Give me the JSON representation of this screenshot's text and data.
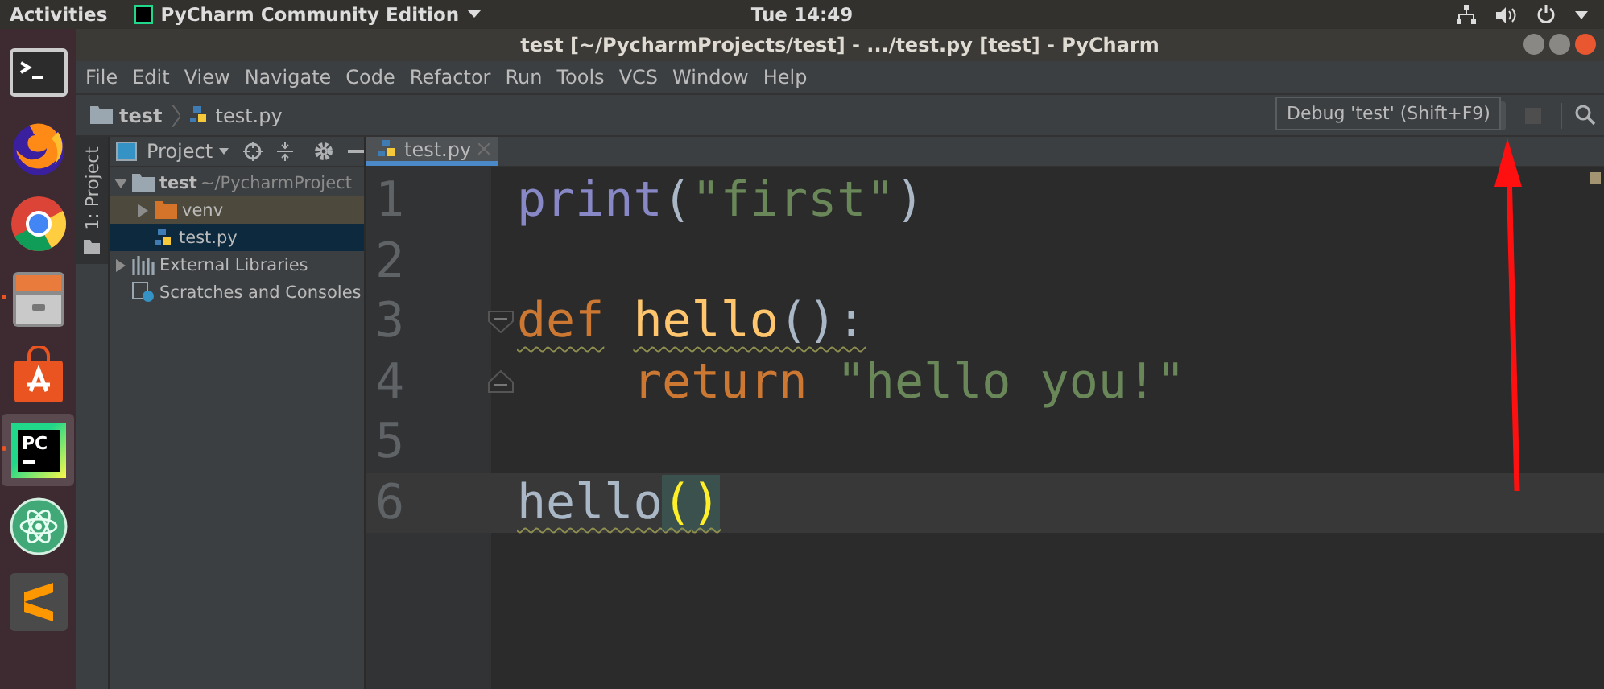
{
  "top_bar": {
    "activities": "Activities",
    "app_menu": "PyCharm Community Edition",
    "clock": "Tue 14:49"
  },
  "dock": [
    {
      "kind": "terminal",
      "running": false,
      "selected": false
    },
    {
      "kind": "fox",
      "running": false,
      "selected": false
    },
    {
      "kind": "browser",
      "running": false,
      "selected": false
    },
    {
      "kind": "drawer",
      "running": true,
      "selected": false
    },
    {
      "kind": "bag",
      "running": false,
      "selected": false
    },
    {
      "kind": "pc",
      "label": "PC",
      "running": true,
      "selected": true
    },
    {
      "kind": "atom",
      "running": false,
      "selected": false
    },
    {
      "kind": "sublime",
      "running": false,
      "selected": false
    }
  ],
  "window": {
    "title": "test [~/PycharmProjects/test] - .../test.py [test] - PyCharm"
  },
  "menu": [
    "File",
    "Edit",
    "View",
    "Navigate",
    "Code",
    "Refactor",
    "Run",
    "Tools",
    "VCS",
    "Window",
    "Help"
  ],
  "breadcrumbs": [
    {
      "kind": "folder",
      "label": "test"
    },
    {
      "kind": "python",
      "label": "test.py"
    }
  ],
  "tooltip": "Debug 'test' (Shift+F9)",
  "toolbar": {
    "stop_disabled": true
  },
  "tool_strip": {
    "label": "1: Project"
  },
  "project_panel": {
    "title": "Project",
    "tree": [
      {
        "kind": "folder",
        "label": "test",
        "path": "~/PycharmProject",
        "expanded": true,
        "selected": false,
        "excluded": false,
        "children": [
          {
            "kind": "excluded-folder",
            "label": "venv",
            "expanded": false,
            "selected": false,
            "excluded": true
          },
          {
            "kind": "python",
            "label": "test.py",
            "selected": true,
            "excluded": false
          }
        ]
      },
      {
        "kind": "libraries",
        "label": "External Libraries",
        "expanded": false,
        "selected": false,
        "excluded": false
      },
      {
        "kind": "scratches",
        "label": "Scratches and Consoles",
        "selected": false,
        "excluded": false
      }
    ]
  },
  "editor": {
    "tabs": [
      {
        "label": "test.py",
        "selected": true
      }
    ],
    "lines": [
      {
        "number": "1",
        "current": false,
        "fold_start": false,
        "fold_end": false,
        "tokens": [
          {
            "text": "print",
            "kind": "builtin",
            "warning": false,
            "space_before": false
          },
          {
            "text": "(",
            "kind": "plain",
            "warning": false,
            "space_before": false
          },
          {
            "text": "\"first\"",
            "kind": "string",
            "warning": false,
            "space_before": false
          },
          {
            "text": ")",
            "kind": "plain",
            "warning": false,
            "space_before": false
          }
        ]
      },
      {
        "number": "2",
        "current": false,
        "fold_start": false,
        "fold_end": false
      },
      {
        "number": "3",
        "current": false,
        "fold_start": true,
        "fold_end": false,
        "tokens": [
          {
            "text": "def",
            "kind": "keyword",
            "warning": true,
            "space_before": false
          },
          {
            "text": "hello",
            "kind": "defname",
            "warning": true,
            "space_before": true
          },
          {
            "text": "():",
            "kind": "plain",
            "warning": true,
            "space_before": false
          }
        ]
      },
      {
        "number": "4",
        "current": false,
        "fold_start": false,
        "fold_end": true,
        "indented": true,
        "tokens": [
          {
            "text": "return",
            "kind": "keyword",
            "warning": false,
            "space_before": false
          },
          {
            "text": "\"hello you!\"",
            "kind": "string",
            "warning": false,
            "space_before": true
          }
        ]
      },
      {
        "number": "5",
        "current": false,
        "fold_start": false,
        "fold_end": false
      },
      {
        "number": "6",
        "current": true,
        "fold_start": false,
        "fold_end": false,
        "tokens": [
          {
            "text": "hello",
            "kind": "plain",
            "warning": true,
            "space_before": false
          },
          {
            "text": "(",
            "kind": "brace",
            "warning": true,
            "space_before": false
          },
          {
            "text": ")",
            "kind": "brace",
            "warning": true,
            "space_before": false
          }
        ]
      }
    ]
  }
}
